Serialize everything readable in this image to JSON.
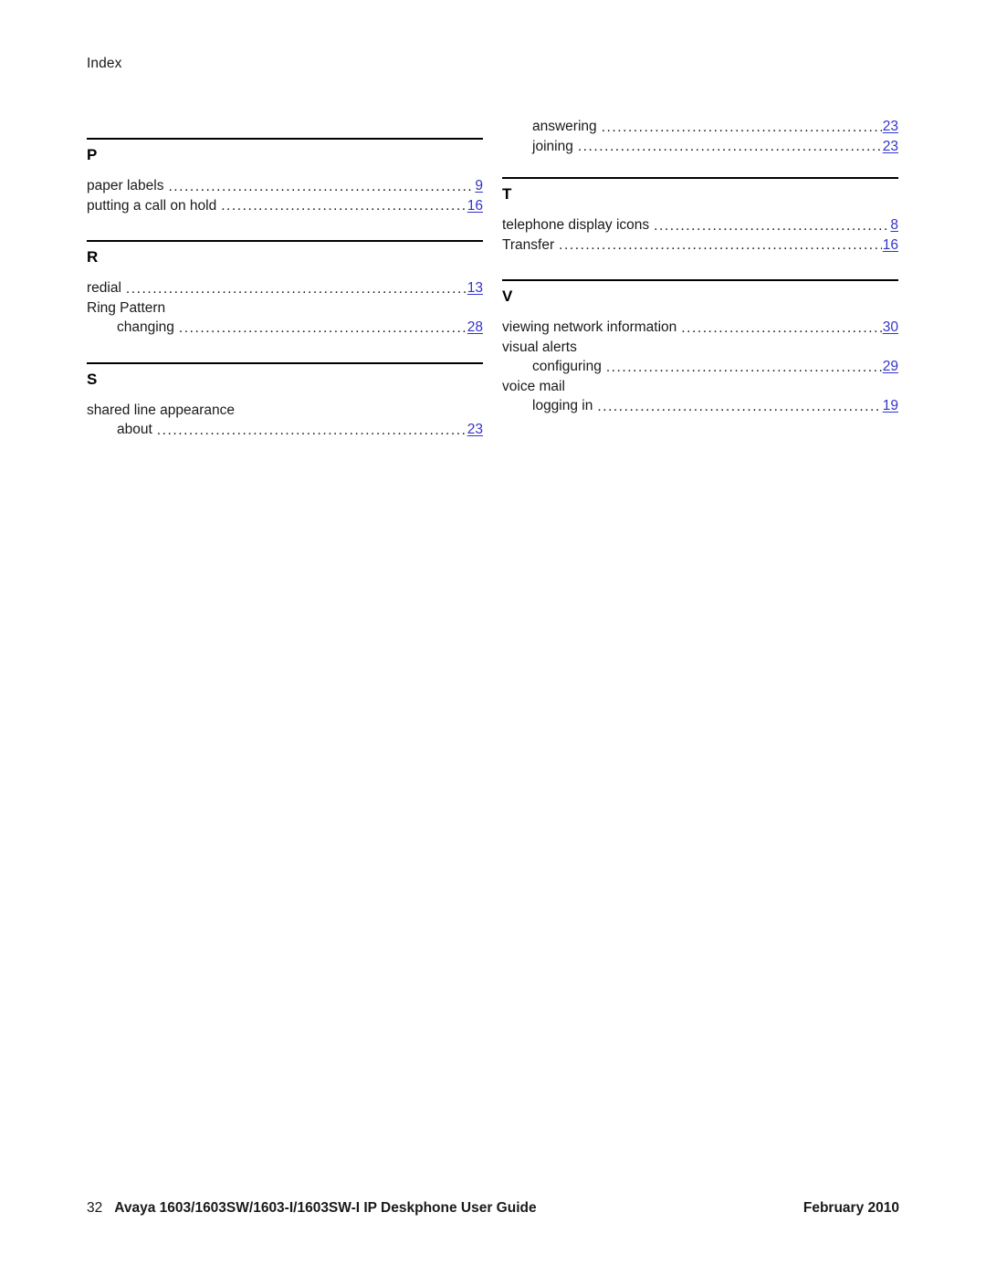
{
  "header": {
    "running_head": "Index"
  },
  "colors": {
    "link": "#3333CC",
    "text": "#1A1A1A",
    "rule": "#000000"
  },
  "columns": {
    "left": {
      "sections": [
        {
          "letter": "P",
          "entries": [
            {
              "term": "paper labels",
              "page": "9",
              "level": 1
            },
            {
              "term": "putting a call on hold",
              "page": "16",
              "level": 1
            }
          ]
        },
        {
          "letter": "R",
          "entries": [
            {
              "term": "redial",
              "page": "13",
              "level": 1
            },
            {
              "term": "Ring Pattern",
              "page": null,
              "level": 1
            },
            {
              "term": "changing",
              "page": "28",
              "level": 2
            }
          ]
        },
        {
          "letter": "S",
          "entries": [
            {
              "term": "shared line appearance",
              "page": null,
              "level": 1
            },
            {
              "term": "about",
              "page": "23",
              "level": 2
            }
          ]
        }
      ]
    },
    "right": {
      "continued_entries": [
        {
          "term": "answering",
          "page": "23",
          "level": 2
        },
        {
          "term": "joining",
          "page": "23",
          "level": 2
        }
      ],
      "sections": [
        {
          "letter": "T",
          "entries": [
            {
              "term": "telephone display icons",
              "page": "8",
              "level": 1
            },
            {
              "term": "Transfer",
              "page": "16",
              "level": 1
            }
          ]
        },
        {
          "letter": "V",
          "entries": [
            {
              "term": "viewing network information",
              "page": "30",
              "level": 1
            },
            {
              "term": "visual alerts",
              "page": null,
              "level": 1
            },
            {
              "term": "configuring",
              "page": "29",
              "level": 2
            },
            {
              "term": "voice mail",
              "page": null,
              "level": 1
            },
            {
              "term": "logging in",
              "page": "19",
              "level": 2
            }
          ]
        }
      ]
    }
  },
  "footer": {
    "page_number": "32",
    "doc_title": "Avaya 1603/1603SW/1603-I/1603SW-I IP Deskphone User Guide",
    "date": "February 2010"
  }
}
